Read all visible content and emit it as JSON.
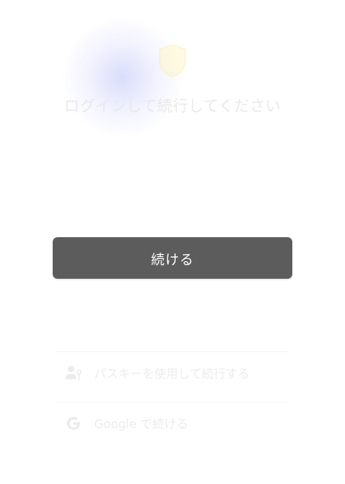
{
  "background": {
    "title": "ログインして続行してください",
    "options": {
      "passkey_label": "パスキーを使用して続行する",
      "google_label": "Google で続ける"
    },
    "icons": {
      "logo": "shield-logo-icon",
      "passkey": "person-key-icon",
      "google": "google-g-icon"
    }
  },
  "continue_button": {
    "label": "続ける"
  },
  "colors": {
    "button_bg": "#5c5c5c",
    "button_text": "#ffffff",
    "faded_text": "#e9e9e9"
  }
}
